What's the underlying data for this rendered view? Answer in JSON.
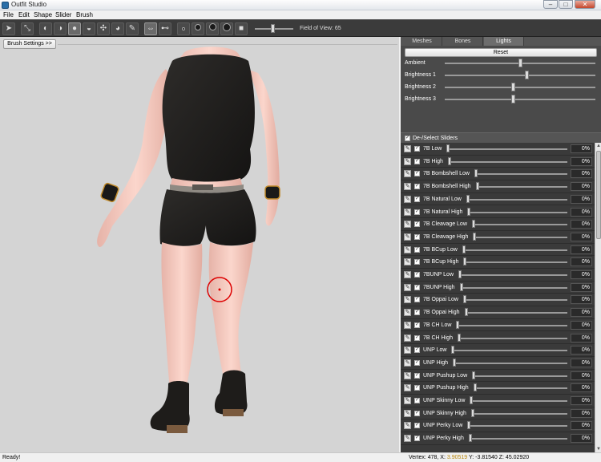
{
  "window": {
    "title": "Outfit Studio",
    "minimize": "–",
    "maximize": "□",
    "close": "✕"
  },
  "menu": [
    "File",
    "Edit",
    "Shape",
    "Slider",
    "Brush"
  ],
  "toolbar": {
    "fov_label": "Field of View: 65",
    "fov_value": 65
  },
  "viewport": {
    "brush_settings_label": "Brush Settings >>"
  },
  "tabs": [
    {
      "label": "Meshes",
      "active": false
    },
    {
      "label": "Bones",
      "active": false
    },
    {
      "label": "Lights",
      "active": true
    }
  ],
  "lights": {
    "reset_label": "Reset",
    "items": [
      {
        "label": "Ambient",
        "level": 0.5
      },
      {
        "label": "Brightness 1",
        "level": 0.54
      },
      {
        "label": "Brightness 2",
        "level": 0.45
      },
      {
        "label": "Brightness 3",
        "level": 0.45
      }
    ]
  },
  "deselect_label": "De-/Select Sliders",
  "sliders": [
    {
      "name": "7B Low",
      "value": "0%"
    },
    {
      "name": "7B High",
      "value": "0%"
    },
    {
      "name": "7B Bombshell Low",
      "value": "0%"
    },
    {
      "name": "7B Bombshell High",
      "value": "0%"
    },
    {
      "name": "7B Natural Low",
      "value": "0%"
    },
    {
      "name": "7B Natural High",
      "value": "0%"
    },
    {
      "name": "7B Cleavage Low",
      "value": "0%"
    },
    {
      "name": "7B Cleavage High",
      "value": "0%"
    },
    {
      "name": "7B BCup Low",
      "value": "0%"
    },
    {
      "name": "7B BCup High",
      "value": "0%"
    },
    {
      "name": "7BUNP Low",
      "value": "0%"
    },
    {
      "name": "7BUNP High",
      "value": "0%"
    },
    {
      "name": "7B Oppai Low",
      "value": "0%"
    },
    {
      "name": "7B Oppai High",
      "value": "0%"
    },
    {
      "name": "7B CH Low",
      "value": "0%"
    },
    {
      "name": "7B CH High",
      "value": "0%"
    },
    {
      "name": "UNP Low",
      "value": "0%"
    },
    {
      "name": "UNP High",
      "value": "0%"
    },
    {
      "name": "UNP Pushup Low",
      "value": "0%"
    },
    {
      "name": "UNP Pushup High",
      "value": "0%"
    },
    {
      "name": "UNP Skinny Low",
      "value": "0%"
    },
    {
      "name": "UNP Skinny High",
      "value": "0%"
    },
    {
      "name": "UNP Perky Low",
      "value": "0%"
    },
    {
      "name": "UNP Perky High",
      "value": "0%"
    }
  ],
  "status": {
    "ready": "Ready!",
    "coords_prefix": "Vertex: 478, X: ",
    "x_value": "3.90519",
    "coords_suffix": " Y: -3.81540 Z: 45.02920"
  }
}
